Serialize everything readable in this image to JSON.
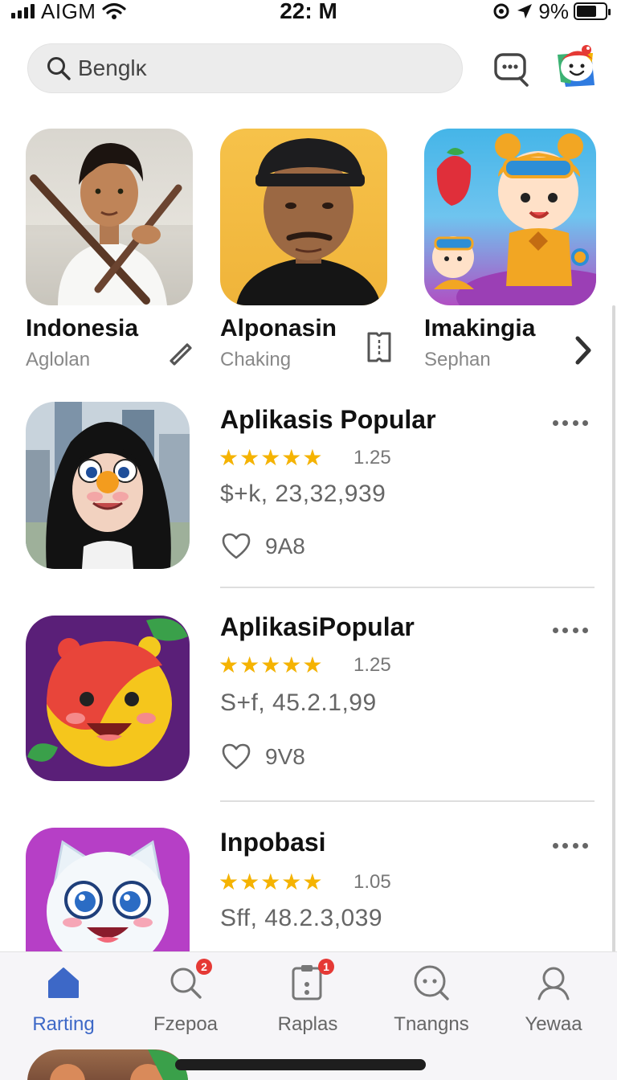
{
  "status_bar": {
    "carrier": "AIGM",
    "time": "22: M",
    "battery_percent": "9%",
    "battery_level": 0.7
  },
  "search": {
    "placeholder": "Benglĸ",
    "icon": "search-icon"
  },
  "header_actions": {
    "chat_icon": "chat-bubble-icon",
    "mascot_icon": "mascot-avatar-icon"
  },
  "featured": [
    {
      "title": "Indonesia",
      "subtitle": "Aglolan",
      "action_icon": "pencil-icon"
    },
    {
      "title": "Alponasin",
      "subtitle": "Chaking",
      "action_icon": "ticket-icon"
    },
    {
      "title": "Imakingia",
      "subtitle": "Sephan",
      "action_icon": "chevron-right-icon"
    }
  ],
  "apps": [
    {
      "title": "Aplikasis Popular",
      "rating": 4.5,
      "rating_text": "1.25",
      "price": "$+k, 23,32,939",
      "likes": "9A8"
    },
    {
      "title": "AplikasiPopular",
      "rating": 4.6,
      "rating_text": "1.25",
      "price": "S+f, 45.2.1,99",
      "likes": "9V8"
    },
    {
      "title": "Inpobasi",
      "rating": 4.7,
      "rating_text": "1.05",
      "price": "Sff, 48.2.3,039"
    }
  ],
  "tabs": [
    {
      "label": "Rarting",
      "icon": "home-icon",
      "active": true
    },
    {
      "label": "Fzepoa",
      "icon": "search-icon",
      "badge": "2"
    },
    {
      "label": "Raplas",
      "icon": "clipboard-icon",
      "badge": "1"
    },
    {
      "label": "Tnangns",
      "icon": "chat-search-icon"
    },
    {
      "label": "Yewaa",
      "icon": "profile-icon"
    }
  ],
  "colors": {
    "accent": "#3d68c7",
    "star": "#f5b301",
    "badge": "#e53935"
  }
}
